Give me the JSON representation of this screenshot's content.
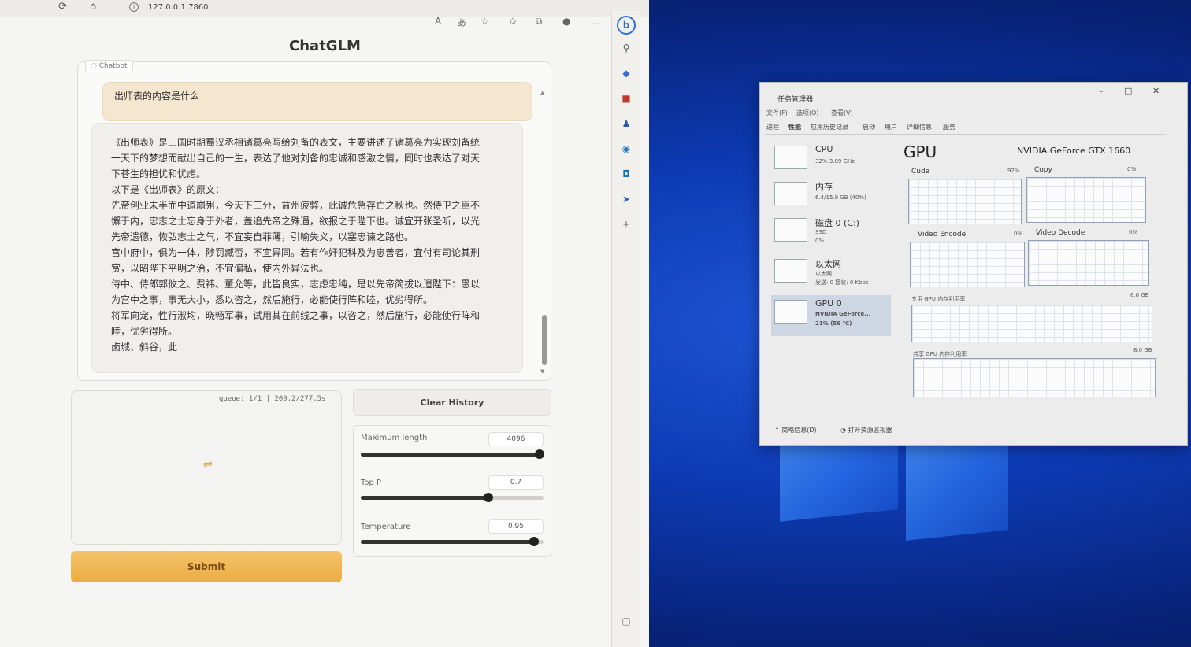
{
  "browser": {
    "url": "127.0.0.1:7860",
    "info_icon": "i"
  },
  "app": {
    "title": "ChatGLM",
    "chatbot_label": "Chatbot",
    "user_message": "出师表的内容是什么",
    "bot_lines": [
      "《出师表》是三国时期蜀汉丞相诸葛亮写给刘备的表文，主要讲述了诸葛亮为实现刘备统",
      "一天下的梦想而献出自己的一生，表达了他对刘备的忠诚和感激之情，同时也表达了对天",
      "下苍生的担忧和忧虑。",
      "以下是《出师表》的原文：",
      "先帝创业未半而中道崩殂，今天下三分，益州疲弊，此诚危急存亡之秋也。然侍卫之臣不",
      "懈于内，忠志之士忘身于外者，盖追先帝之殊遇，欲报之于陛下也。诚宜开张圣听，以光",
      "先帝遗德，恢弘志士之气，不宜妄自菲薄，引喻失义，以塞忠谏之路也。",
      "宫中府中，俱为一体，陟罚臧否，不宜异同。若有作奸犯科及为忠善者，宜付有司论其刑",
      "赏，以昭陛下平明之治，不宜偏私，使内外异法也。",
      "侍中、侍郎郭攸之、费祎、董允等，此皆良实，志虑忠纯，是以先帝简拔以遗陛下：愚以",
      "为宫中之事，事无大小，悉以咨之，然后施行，必能使行阵和睦，优劣得所。",
      "将军向宠，性行淑均，晓畅军事，试用其在前线之事，以咨之，然后施行，必能使行阵和",
      "睦，优劣得所。",
      "卤城、斜谷，此"
    ],
    "queue_status": "queue: 1/1 | 209.2/277.5s",
    "clear_label": "Clear History",
    "submit_label": "Submit",
    "sliders": [
      {
        "label": "Maximum length",
        "value": "4096",
        "fraction": 0.98
      },
      {
        "label": "Top P",
        "value": "0.7",
        "fraction": 0.7
      },
      {
        "label": "Temperature",
        "value": "0.95",
        "fraction": 0.95
      }
    ]
  },
  "taskmgr": {
    "title": "任务管理器",
    "menus": [
      "文件(F)",
      "选项(O)",
      "查看(V)"
    ],
    "tabs": [
      "进程",
      "性能",
      "应用历史记录",
      "启动",
      "用户",
      "详细信息",
      "服务"
    ],
    "resources": [
      {
        "name": "CPU",
        "sub1": "32%  3.89 GHz",
        "sub2": ""
      },
      {
        "name": "内存",
        "sub1": "6.4/15.9 GB (40%)",
        "sub2": ""
      },
      {
        "name": "磁盘 0 (C:)",
        "sub1": "SSD",
        "sub2": "0%"
      },
      {
        "name": "以太网",
        "sub1": "以太网",
        "sub2": "发送: 0 接收: 0 Kbps"
      },
      {
        "name": "GPU 0",
        "sub1": "NVIDIA GeForce...",
        "sub2": "21% (56 °C)"
      }
    ],
    "gpu_title": "GPU",
    "gpu_model": "NVIDIA GeForce GTX 1660",
    "graphs": {
      "cuda": {
        "label": "Cuda",
        "pct": "92%"
      },
      "copy": {
        "label": "Copy",
        "pct": "0%"
      },
      "venc": {
        "label": "Video Encode",
        "pct": "0%"
      },
      "vdec": {
        "label": "Video Decode",
        "pct": "0%"
      },
      "dedicated": {
        "label": "专用 GPU 内存利用率",
        "cap": "6.0 GB"
      },
      "shared": {
        "label": "共享 GPU 内存利用率",
        "cap": "8.0 GB"
      }
    },
    "footer_brief": "简略信息(D)",
    "footer_monitor": "打开资源监视器"
  }
}
